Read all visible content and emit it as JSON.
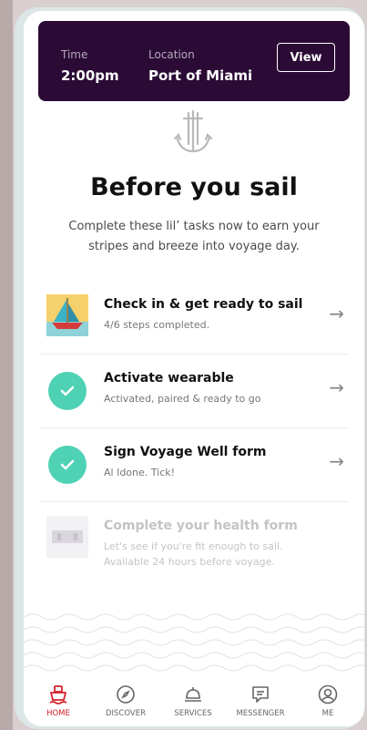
{
  "header": {
    "time_label": "Time",
    "time_value": "2:00pm",
    "location_label": "Location",
    "location_value": "Port of Miami",
    "view_label": "View"
  },
  "intro": {
    "title": "Before you sail",
    "subtitle": "Complete these lil’ tasks now to earn your stripes and breeze into voyage day."
  },
  "tasks": [
    {
      "title": "Check in & get ready to sail",
      "subtitle": "4/6 steps completed.",
      "icon": "sailboat-icon"
    },
    {
      "title": "Activate wearable",
      "subtitle": "Activated, paired & ready to go",
      "icon": "check-icon"
    },
    {
      "title": "Sign Voyage Well form",
      "subtitle": "Al Idone. Tick!",
      "icon": "check-icon"
    },
    {
      "title": "Complete your health form",
      "subtitle": "Let's see if you're fit enough to sail. Available 24 hours before voyage.",
      "icon": "health-form-icon"
    }
  ],
  "nav": [
    {
      "label": "HOME",
      "icon": "ship-icon",
      "active": true
    },
    {
      "label": "DISCOVER",
      "icon": "compass-icon",
      "active": false
    },
    {
      "label": "SERVICES",
      "icon": "bell-icon",
      "active": false
    },
    {
      "label": "MESSENGER",
      "icon": "chat-icon",
      "active": false
    },
    {
      "label": "ME",
      "icon": "user-icon",
      "active": false
    }
  ],
  "colors": {
    "header_bg": "#2b0b36",
    "accent_teal": "#4fd1b4",
    "active_red": "#d6202a"
  }
}
